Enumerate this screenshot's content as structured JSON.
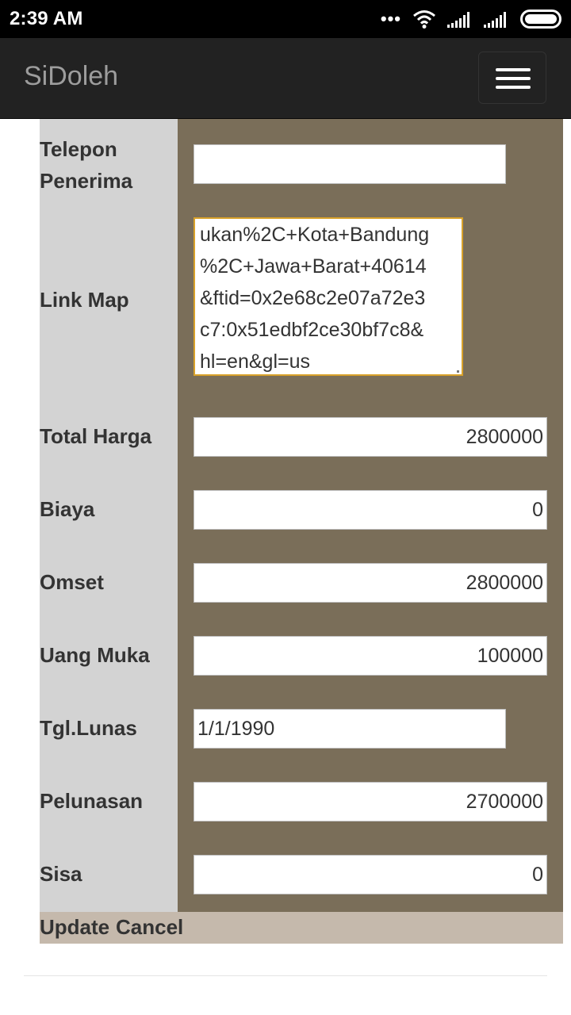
{
  "status_bar": {
    "time": "2:39 AM",
    "icons": [
      "more-dots-icon",
      "wifi-icon",
      "signal-icon",
      "signal-icon",
      "battery-icon"
    ]
  },
  "navbar": {
    "brand": "SiDoleh",
    "menu_icon": "hamburger-icon"
  },
  "form": {
    "telepon_penerima": {
      "label_line1": "Telepon",
      "label_line2": "Penerima",
      "value": ""
    },
    "link_map": {
      "label": "Link Map",
      "lines": [
        "ukan%2C+Kota+Bandung",
        "%2C+Jawa+Barat+40614",
        "&ftid=0x2e68c2e07a72e3",
        "c7:0x51edbf2ce30bf7c8&",
        "hl=en&gl=us"
      ]
    },
    "total_harga": {
      "label": "Total Harga",
      "value": "2800000"
    },
    "biaya": {
      "label": "Biaya",
      "value": "0"
    },
    "omset": {
      "label": "Omset",
      "value": "2800000"
    },
    "uang_muka": {
      "label": "Uang Muka",
      "value": "100000"
    },
    "tgl_lunas": {
      "label": "Tgl.Lunas",
      "value": "1/1/1990"
    },
    "pelunasan": {
      "label": "Pelunasan",
      "value": "2700000"
    },
    "sisa": {
      "label": "Sisa",
      "value": "0"
    }
  },
  "actions": {
    "update": "Update",
    "cancel": "Cancel"
  },
  "colors": {
    "label_bg": "#d3d3d3",
    "field_bg": "#7a6e59",
    "footer_bg": "#c5b9ac",
    "navbar_bg": "#222222",
    "focus_border": "#d8a12a"
  }
}
